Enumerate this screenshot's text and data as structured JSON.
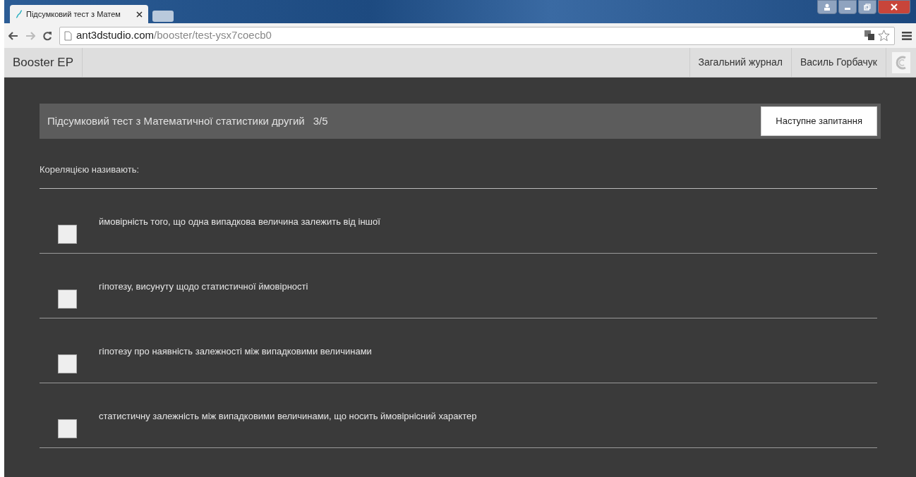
{
  "browser": {
    "tab_title": "Підсумковий тест з Матем",
    "url": {
      "host": "ant3dstudio.com",
      "path": "/booster/test-ysx7coecb0"
    }
  },
  "navbar": {
    "brand": "Booster EP",
    "links": [
      "Загальний журнал",
      "Василь Горбачук"
    ]
  },
  "test": {
    "title": "Підсумковий тест з Математичної статистики другий",
    "progress": "3/5",
    "next_button": "Наступне запитання"
  },
  "question": "Кореляцією називають:",
  "options": [
    {
      "text": "ймовірність того, що одна випадкова величина залежить від іншої",
      "checked": false
    },
    {
      "text": "гіпотезу, висунуту щодо статистичної ймовірності",
      "checked": false
    },
    {
      "text": "гіпотезу про наявність залежності між випадковими величинами",
      "checked": false
    },
    {
      "text": "статистичну залежність між випадковими величинами, що носить ймовірнісний характер",
      "checked": false
    }
  ]
}
